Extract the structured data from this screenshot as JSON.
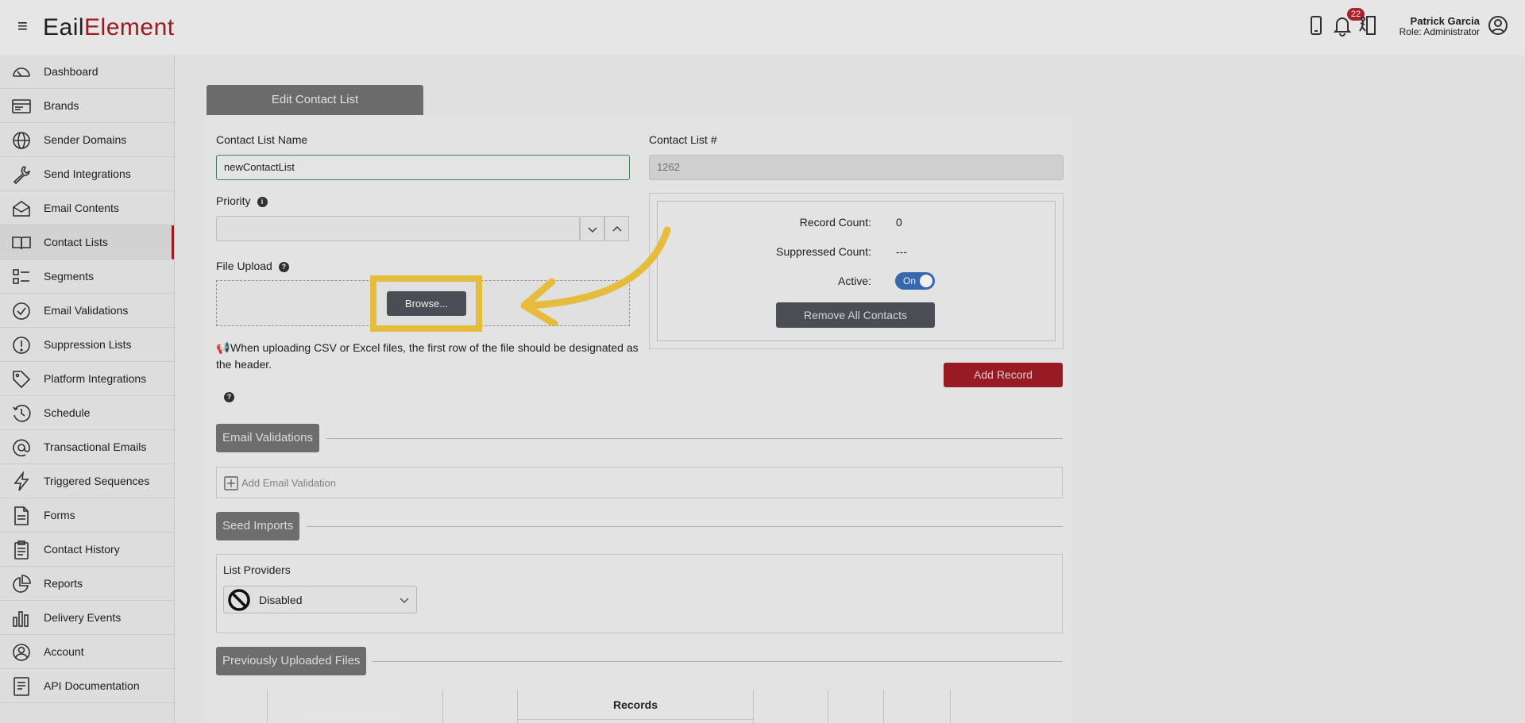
{
  "header": {
    "logo_part1": "E",
    "logo_mid": "ail",
    "logo_part2": "Element",
    "notification_count": "22",
    "user_name": "Patrick Garcia",
    "user_role": "Role: Administrator"
  },
  "sidebar": {
    "items": [
      {
        "label": "Dashboard",
        "icon": "gauge-icon"
      },
      {
        "label": "Brands",
        "icon": "brand-card-icon"
      },
      {
        "label": "Sender Domains",
        "icon": "globe-icon"
      },
      {
        "label": "Send Integrations",
        "icon": "wrench-icon"
      },
      {
        "label": "Email Contents",
        "icon": "envelope-open-icon"
      },
      {
        "label": "Contact Lists",
        "icon": "book-icon"
      },
      {
        "label": "Segments",
        "icon": "list-segments-icon"
      },
      {
        "label": "Email Validations",
        "icon": "check-circle-icon"
      },
      {
        "label": "Suppression Lists",
        "icon": "exclamation-circle-icon"
      },
      {
        "label": "Platform Integrations",
        "icon": "tag-icon"
      },
      {
        "label": "Schedule",
        "icon": "clock-history-icon"
      },
      {
        "label": "Transactional Emails",
        "icon": "at-sign-icon"
      },
      {
        "label": "Triggered Sequences",
        "icon": "lightning-icon"
      },
      {
        "label": "Forms",
        "icon": "document-icon"
      },
      {
        "label": "Contact History",
        "icon": "clipboard-icon"
      },
      {
        "label": "Reports",
        "icon": "pie-chart-icon"
      },
      {
        "label": "Delivery Events",
        "icon": "bar-chart-icon"
      },
      {
        "label": "Account",
        "icon": "user-circle-icon"
      },
      {
        "label": "API Documentation",
        "icon": "api-doc-icon"
      }
    ],
    "active_index": 5
  },
  "main": {
    "tab_label": "Edit Contact List",
    "name_label": "Contact List Name",
    "name_value": "newContactList",
    "number_label": "Contact List #",
    "number_value": "1262",
    "priority_label": "Priority",
    "priority_value": "",
    "file_upload_label": "File Upload",
    "browse_label": "Browse...",
    "upload_note": "When uploading CSV or Excel files, the first row of the file should be designated as the header.",
    "stats": {
      "record_count_label": "Record Count:",
      "record_count_value": "0",
      "suppressed_label": "Suppressed Count:",
      "suppressed_value": "---",
      "active_label": "Active:",
      "active_value": "On"
    },
    "remove_all_label": "Remove All Contacts",
    "add_record_label": "Add Record",
    "email_validations_section": "Email Validations",
    "add_email_validation_label": "Add Email Validation",
    "seed_imports_section": "Seed Imports",
    "list_providers_label": "List Providers",
    "list_providers_value": "Disabled",
    "previous_files_section": "Previously Uploaded Files",
    "records_header": "Records"
  },
  "colors": {
    "brand_red": "#a21d27",
    "highlight_yellow": "#f5c840",
    "toggle_blue": "#3b6fb8"
  }
}
